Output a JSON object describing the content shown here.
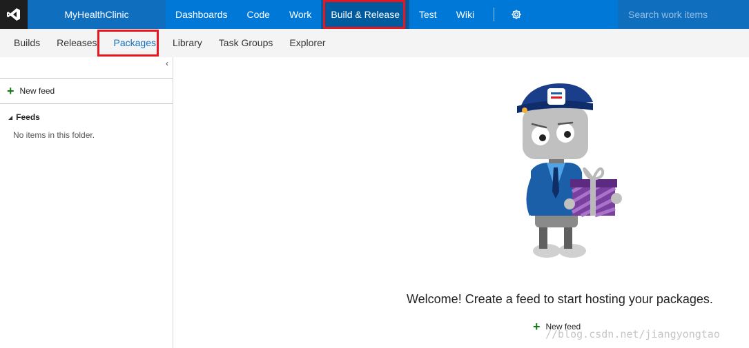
{
  "topbar": {
    "project_name": "MyHealthClinic",
    "nav": [
      "Dashboards",
      "Code",
      "Work",
      "Build & Release",
      "Test",
      "Wiki"
    ],
    "active_nav": "Build & Release",
    "settings_icon": "gear-icon",
    "search_placeholder": "Search work items"
  },
  "subnav": {
    "items": [
      "Builds",
      "Releases",
      "Packages",
      "Library",
      "Task Groups",
      "Explorer"
    ],
    "active": "Packages"
  },
  "leftpane": {
    "new_feed_label": "New feed",
    "feeds_heading": "Feeds",
    "empty_text": "No items in this folder."
  },
  "main": {
    "welcome_text": "Welcome! Create a feed to start hosting your packages.",
    "new_feed_label": "New feed"
  },
  "watermark": "//blog.csdn.net/jiangyongtao",
  "colors": {
    "accent": "#0078d7",
    "highlight": "#e8161f",
    "add_green": "#107c10"
  }
}
